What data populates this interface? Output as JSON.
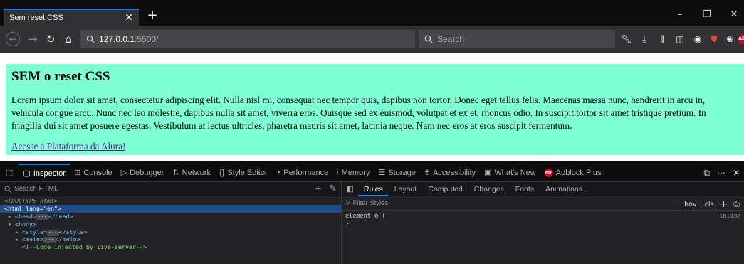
{
  "browser": {
    "tab_title": "Sem reset CSS",
    "new_tab_symbol": "+",
    "url_host": "127.0.0.1",
    "url_path": ":5500/",
    "search_placeholder": "Search"
  },
  "page": {
    "heading": "SEM o reset CSS",
    "paragraph": "Lorem ipsum dolor sit amet, consectetur adipiscing elit. Nulla nisl mi, consequat nec tempor quis, dapibus non tortor. Donec eget tellus felis. Maecenas massa nunc, hendrerit in arcu in, vehicula congue arcu. Nunc nec leo molestie, dapibus nulla sit amet, viverra eros. Quisque sed ex euismod, volutpat et ex et, rhoncus odio. In suscipit tortor sit amet tristique pretium. In fringilla dui sit amet posuere egestas. Vestibulum at lectus ultricies, pharetra mauris sit amet, lacinia neque. Nam nec eros at eros suscipit fermentum.",
    "link": "Acesse a Plataforma da Alura!",
    "background": "#7fffd4"
  },
  "devtools": {
    "tabs": [
      {
        "label": "Inspector",
        "icon": "inspector-icon"
      },
      {
        "label": "Console",
        "icon": "console-icon"
      },
      {
        "label": "Debugger",
        "icon": "debugger-icon"
      },
      {
        "label": "Network",
        "icon": "network-icon"
      },
      {
        "label": "Style Editor",
        "icon": "style-editor-icon"
      },
      {
        "label": "Performance",
        "icon": "performance-icon"
      },
      {
        "label": "Memory",
        "icon": "memory-icon"
      },
      {
        "label": "Storage",
        "icon": "storage-icon"
      },
      {
        "label": "Accessibility",
        "icon": "accessibility-icon"
      },
      {
        "label": "What's New",
        "icon": "gift-icon"
      },
      {
        "label": "Adblock Plus",
        "icon": "adblock-icon"
      }
    ],
    "html_search_placeholder": "Search HTML",
    "tree": {
      "doctype": "<!DOCTYPE html>",
      "html_tag": "html",
      "html_attr": "lang",
      "html_val": "\"en\"",
      "head": "head",
      "body": "body",
      "style": "style",
      "main": "main",
      "comment": "<!--Code injected by live-server-->"
    },
    "sub_tabs": [
      "Rules",
      "Layout",
      "Computed",
      "Changes",
      "Fonts",
      "Animations"
    ],
    "filter_placeholder": "Filter Styles",
    "hov_label": ":hov",
    "cls_label": ".cls",
    "rule_selector": "element",
    "rule_open": "{",
    "rule_close": "}",
    "rule_source": "inline"
  },
  "colors": {
    "accent": "#0a84ff",
    "selected_row": "#204e8a"
  }
}
